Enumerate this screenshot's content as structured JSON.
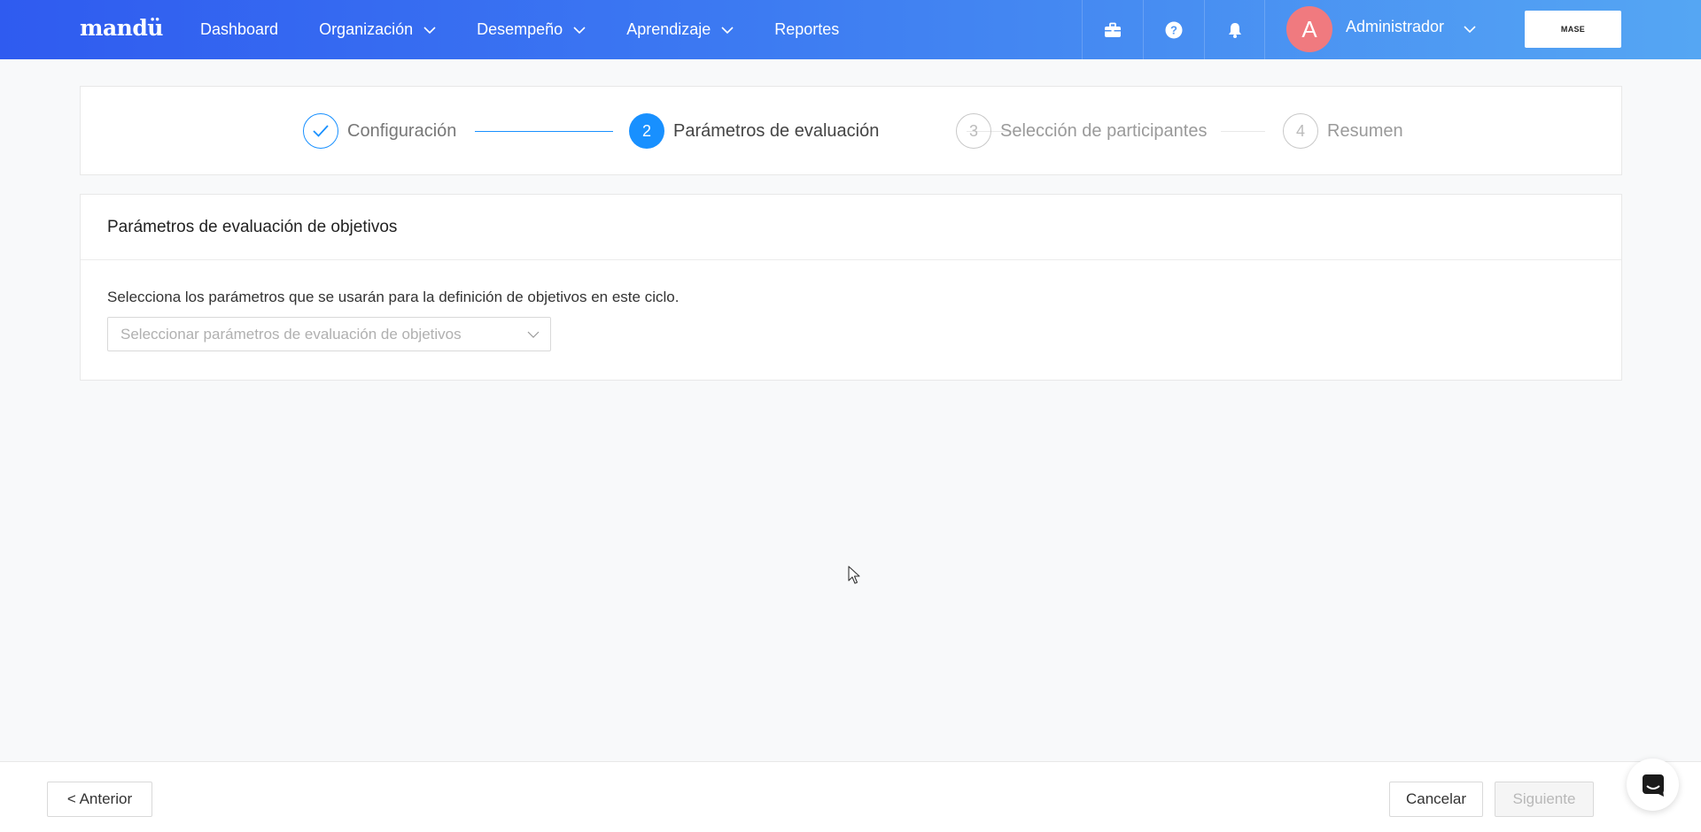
{
  "app": {
    "logo": "mandü"
  },
  "nav": {
    "items": [
      {
        "label": "Dashboard",
        "has_dropdown": false
      },
      {
        "label": "Organización",
        "has_dropdown": true
      },
      {
        "label": "Desempeño",
        "has_dropdown": true
      },
      {
        "label": "Aprendizaje",
        "has_dropdown": true
      },
      {
        "label": "Reportes",
        "has_dropdown": false
      }
    ]
  },
  "header": {
    "icons": [
      "briefcase-icon",
      "help-icon",
      "bell-icon"
    ],
    "user": {
      "initial": "A",
      "name": "Administrador"
    },
    "company_logo_text": "MASE"
  },
  "steps": [
    {
      "number": "1",
      "label": "Configuración",
      "status": "done"
    },
    {
      "number": "2",
      "label": "Parámetros de evaluación",
      "status": "active"
    },
    {
      "number": "3",
      "label": "Selección de participantes",
      "status": "todo"
    },
    {
      "number": "4",
      "label": "Resumen",
      "status": "todo"
    }
  ],
  "card": {
    "title": "Parámetros de evaluación de objetivos",
    "description": "Selecciona los parámetros que se usarán para la definición de objetivos en este ciclo.",
    "select_placeholder": "Seleccionar parámetros de evaluación de objetivos"
  },
  "footer": {
    "prev_label": "< Anterior",
    "cancel_label": "Cancelar",
    "next_label": "Siguiente"
  },
  "colors": {
    "accent": "#1890ff",
    "nav_gradient_start": "#2f5bf0",
    "nav_gradient_end": "#55a6f3",
    "avatar": "#f07a7f"
  }
}
